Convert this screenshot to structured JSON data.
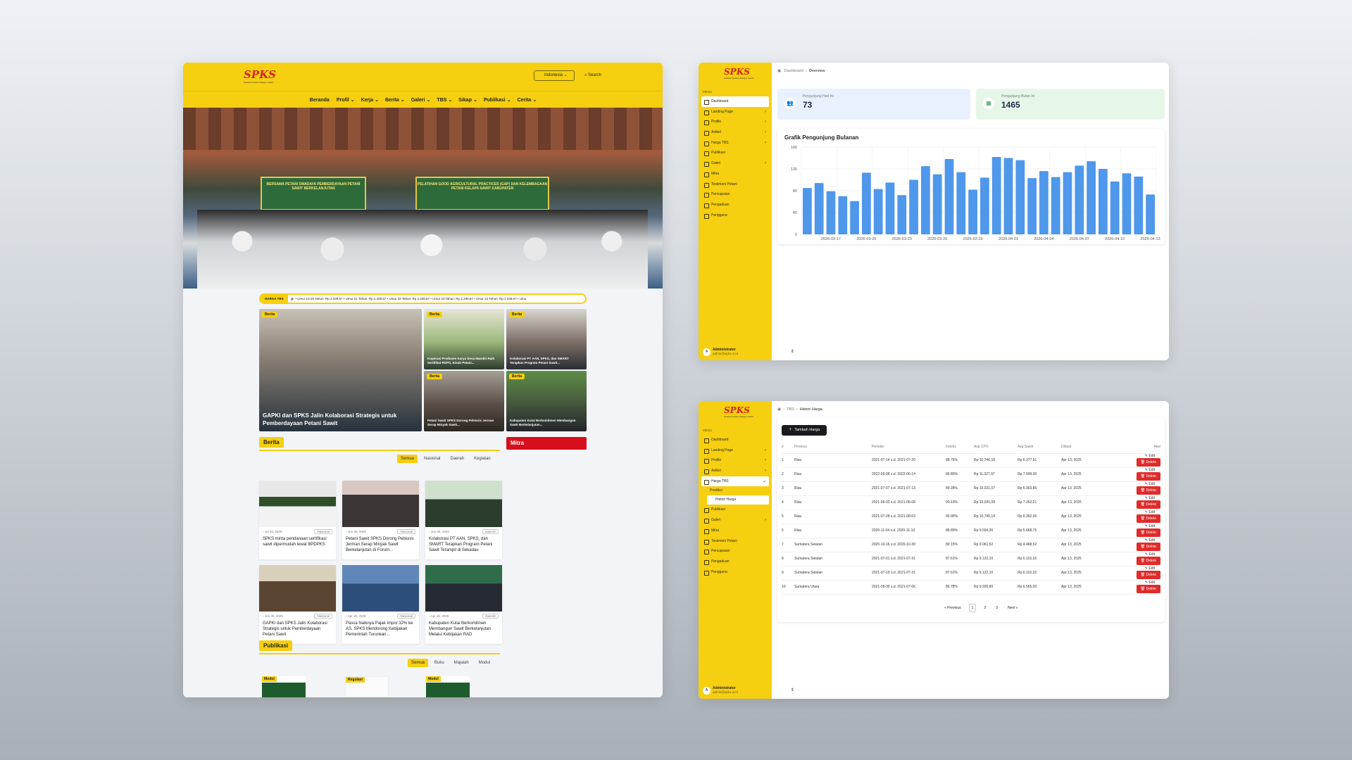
{
  "site": {
    "logo": "SPKS",
    "logo_tagline": "Serikat Petani Kelapa Sawit",
    "lang": "Indonesia",
    "search": "Search",
    "nav": [
      "Beranda",
      "Profil",
      "Kerja",
      "Berita",
      "Galeri",
      "TBS",
      "Sikap",
      "Publikasi",
      "Cerita"
    ],
    "hero": {
      "banner1": "BERSAMA PETANI SWADAYA PEMBERDAYAAN PETANI SAWIT BERKELANJUTAN",
      "banner2": "PELATIHAN GOOD AGRICULTURAL PRACTICES (GAP) DAN KELEMBAGAAN PETANI KELAPA SAWIT KABUPATEN"
    },
    "ticker": {
      "label": "HARGA TBS",
      "text": "• Umur 10-20 Tahun: Rp 2.339,67 • Umur 21 Tahun: Rp 2.339,67 • Umur 22 Tahun: Rp 2.339,67 • Umur 23 Tahun: Rp 2.339,67 • Umur 24 Tahun: Rp 2.339,67 • Umu"
    },
    "featured": [
      {
        "badge": "Berita",
        "caption": "GAPKI dan SPKS Jalin Kolaborasi Strategis untuk Pemberdayaan Petani Sawit"
      },
      {
        "badge": "Berita",
        "caption": "Koperasi Produsen Karya Desa Mandiri Raih Sertifikat RSPO, Kisah Petani..."
      },
      {
        "badge": "Berita",
        "caption": "Kolaborasi PT AAN, SPKS, dan SMART Terapkan Program Petani Sawit..."
      },
      {
        "badge": "Berita",
        "caption": "Petani Sawit SPKS Dorong Pebisnis Jerman Serap Minyak Sawit..."
      },
      {
        "badge": "Berita",
        "caption": "Kabupaten Kutai Berkomitmen Membangun Sawit Berkelanjutan..."
      }
    ],
    "berita_title": "Berita",
    "mitra_title": "Mitra",
    "berita_filters": [
      "Semua",
      "Nasional",
      "Daerah",
      "Kegiatan"
    ],
    "cards": [
      {
        "date": "Jul 02, 2025",
        "cat": "Nasional",
        "title": "SPKS minta pendanaan sertifikasi sawit dipermudah lewat BPDPKS"
      },
      {
        "date": "Jun 30, 2025",
        "cat": "Nasional",
        "title": "Petani Sawit SPKS Dorong Pebisnis Jerman Serap Minyak Sawit Berkelanjutan di Forum..."
      },
      {
        "date": "Jun 30, 2025",
        "cat": "Daerah",
        "title": "Kolaborasi PT AAN, SPKS, dan SMART Terapkan Program Petani Sawit Terampil di Sekadau"
      },
      {
        "date": "Jun 30, 2025",
        "cat": "Nasional",
        "title": "GAPKI dan SPKS Jalin Kolaborasi Strategis untuk Pemberdayaan Petani Sawit"
      },
      {
        "date": "Apr 18, 2025",
        "cat": "Nasional",
        "title": "Pasca Naiknya Pajak Impor 32% ke AS, SPKS Mendorong Kebijakan Pemerintah Turunkan..."
      },
      {
        "date": "Apr 16, 2025",
        "cat": "Daerah",
        "title": "Kabupaten Kutai Berkomitmen Membangun Sawit Berkelanjutan Melalui Kebijakan RAD"
      }
    ],
    "publikasi_title": "Publikasi",
    "pub_filters": [
      "Semua",
      "Buku",
      "Majalah",
      "Modul"
    ],
    "pubs": [
      {
        "badge": "Modul"
      },
      {
        "badge": "Regulasi"
      },
      {
        "badge": "Modul"
      }
    ]
  },
  "admin": {
    "logo": "SPKS",
    "menu_title": "MENU",
    "menu": [
      "Dashboard",
      "Landing Page",
      "Profile",
      "Artikel",
      "Harga TBS",
      "Publikasi",
      "Galeri",
      "Mitra",
      "Testimoni Petani",
      "Pencapaian",
      "Pengaduan",
      "Pengguna"
    ],
    "menu_chevrons": [
      false,
      true,
      true,
      true,
      true,
      false,
      true,
      false,
      false,
      false,
      false,
      false
    ],
    "user_name": "Administrator",
    "user_email": "admin@spks.or.id",
    "user_avatar": "A",
    "dashboard": {
      "crumb": [
        "Dashboard",
        "Overview"
      ],
      "stats": [
        {
          "label": "Pengunjung Hari Ini",
          "value": "73",
          "bg": "#e8f1fd",
          "icon_color": "#3b6fd8"
        },
        {
          "label": "Pengunjung Bulan Ini",
          "value": "1465",
          "bg": "#e6f7ea",
          "icon_color": "#2fa34f"
        }
      ],
      "chart_title": "Grafik Pengunjung Bulanan"
    },
    "harga": {
      "crumb": [
        "TBS",
        "Histori Harga"
      ],
      "submenu": [
        "Prediksi",
        "Histori Harga"
      ],
      "add_button": "Tambah Harga",
      "headers": [
        "#",
        "Provinsi",
        "Periode",
        "Indeks",
        "Avg CPO",
        "Avg Sawit",
        "Dibuat",
        "Aksi"
      ],
      "rows": [
        [
          "1",
          "Riau",
          "2021-07-14 s.d. 2021-07-20",
          "88.76%",
          "Rp 10,746,18",
          "Rp 6.377,91",
          "Apr 13, 2025"
        ],
        [
          "2",
          "Riau",
          "2022-06-08 s.d. 2022-06-14",
          "80.80%",
          "Rp 11.327,97",
          "Rp 7.699,00",
          "Apr 13, 2025"
        ],
        [
          "3",
          "Riau",
          "2021-07-07 s.d. 2021-07-13",
          "89.28%",
          "Rp 10,021,07",
          "Rp 6.363,85",
          "Apr 13, 2025"
        ],
        [
          "4",
          "Riau",
          "2021-06-02 s.d. 2021-06-08",
          "90.19%",
          "Rp 10,020,09",
          "Rp 7.262,21",
          "Apr 13, 2025"
        ],
        [
          "5",
          "Riau",
          "2021-07-28 s.d. 2021-08-03",
          "90.99%",
          "Rp 10,745,14",
          "Rp 6.362,69",
          "Apr 13, 2025"
        ],
        [
          "6",
          "Riau",
          "2020-11-04 s.d. 2020-11-10",
          "88.89%",
          "Rp 9.594,36",
          "Rp 5.668,75",
          "Apr 13, 2025"
        ],
        [
          "7",
          "Sumatera Selatan",
          "2020-10-16 s.d. 2020-10-30",
          "80.15%",
          "Rp 9.061,62",
          "Rp 4.468,52",
          "Apr 13, 2025"
        ],
        [
          "8",
          "Sumatera Selatan",
          "2021-07-01 s.d. 2021-07-31",
          "87.61%",
          "Rp 9.122,10",
          "Rp 6.119,18",
          "Apr 13, 2025"
        ],
        [
          "9",
          "Sumatera Selatan",
          "2021-07-19 s.d. 2021-07-31",
          "87.61%",
          "Rp 9.122,10",
          "Rp 6.119,18",
          "Apr 13, 2025"
        ],
        [
          "10",
          "Sumatera Utara",
          "2021-06-30 s.d. 2021-07-06",
          "86.78%",
          "Rp 9.930,80",
          "Rp 6.565,00",
          "Apr 13, 2025"
        ]
      ],
      "edit_label": "Edit",
      "delete_label": "Delete",
      "pager": [
        "« Previous",
        "1",
        "2",
        "3",
        "Next »"
      ]
    }
  },
  "chart_data": {
    "type": "bar",
    "title": "Grafik Pengunjung Bulanan",
    "ylim": [
      0,
      160
    ],
    "yticks": [
      0,
      40,
      80,
      120,
      160
    ],
    "x": [
      "2026-03-15",
      "2026-03-16",
      "2026-03-17",
      "2026-03-18",
      "2026-03-19",
      "2026-03-20",
      "2026-03-21",
      "2026-03-22",
      "2026-03-23",
      "2026-03-24",
      "2026-03-25",
      "2026-03-26",
      "2026-03-27",
      "2026-03-28",
      "2026-03-29",
      "2026-03-30",
      "2026-03-31",
      "2026-04-01",
      "2026-04-02",
      "2026-04-03",
      "2026-04-04",
      "2026-04-05",
      "2026-04-06",
      "2026-04-07",
      "2026-04-08",
      "2026-04-09",
      "2026-04-10",
      "2026-04-11",
      "2026-04-12",
      "2026-04-13"
    ],
    "xtick_labels": [
      "2026-03-17",
      "2026-03-20",
      "2026-03-23",
      "2026-03-26",
      "2026-03-29",
      "2026-04-01",
      "2026-04-04",
      "2026-04-07",
      "2026-04-10",
      "2026-04-13"
    ],
    "values": [
      85,
      94,
      79,
      70,
      61,
      113,
      83,
      95,
      72,
      100,
      125,
      110,
      138,
      114,
      82,
      104,
      142,
      140,
      136,
      103,
      116,
      105,
      114,
      126,
      134,
      120,
      97,
      112,
      106,
      73
    ],
    "grid": true,
    "bar_color": "#4f97ea"
  }
}
